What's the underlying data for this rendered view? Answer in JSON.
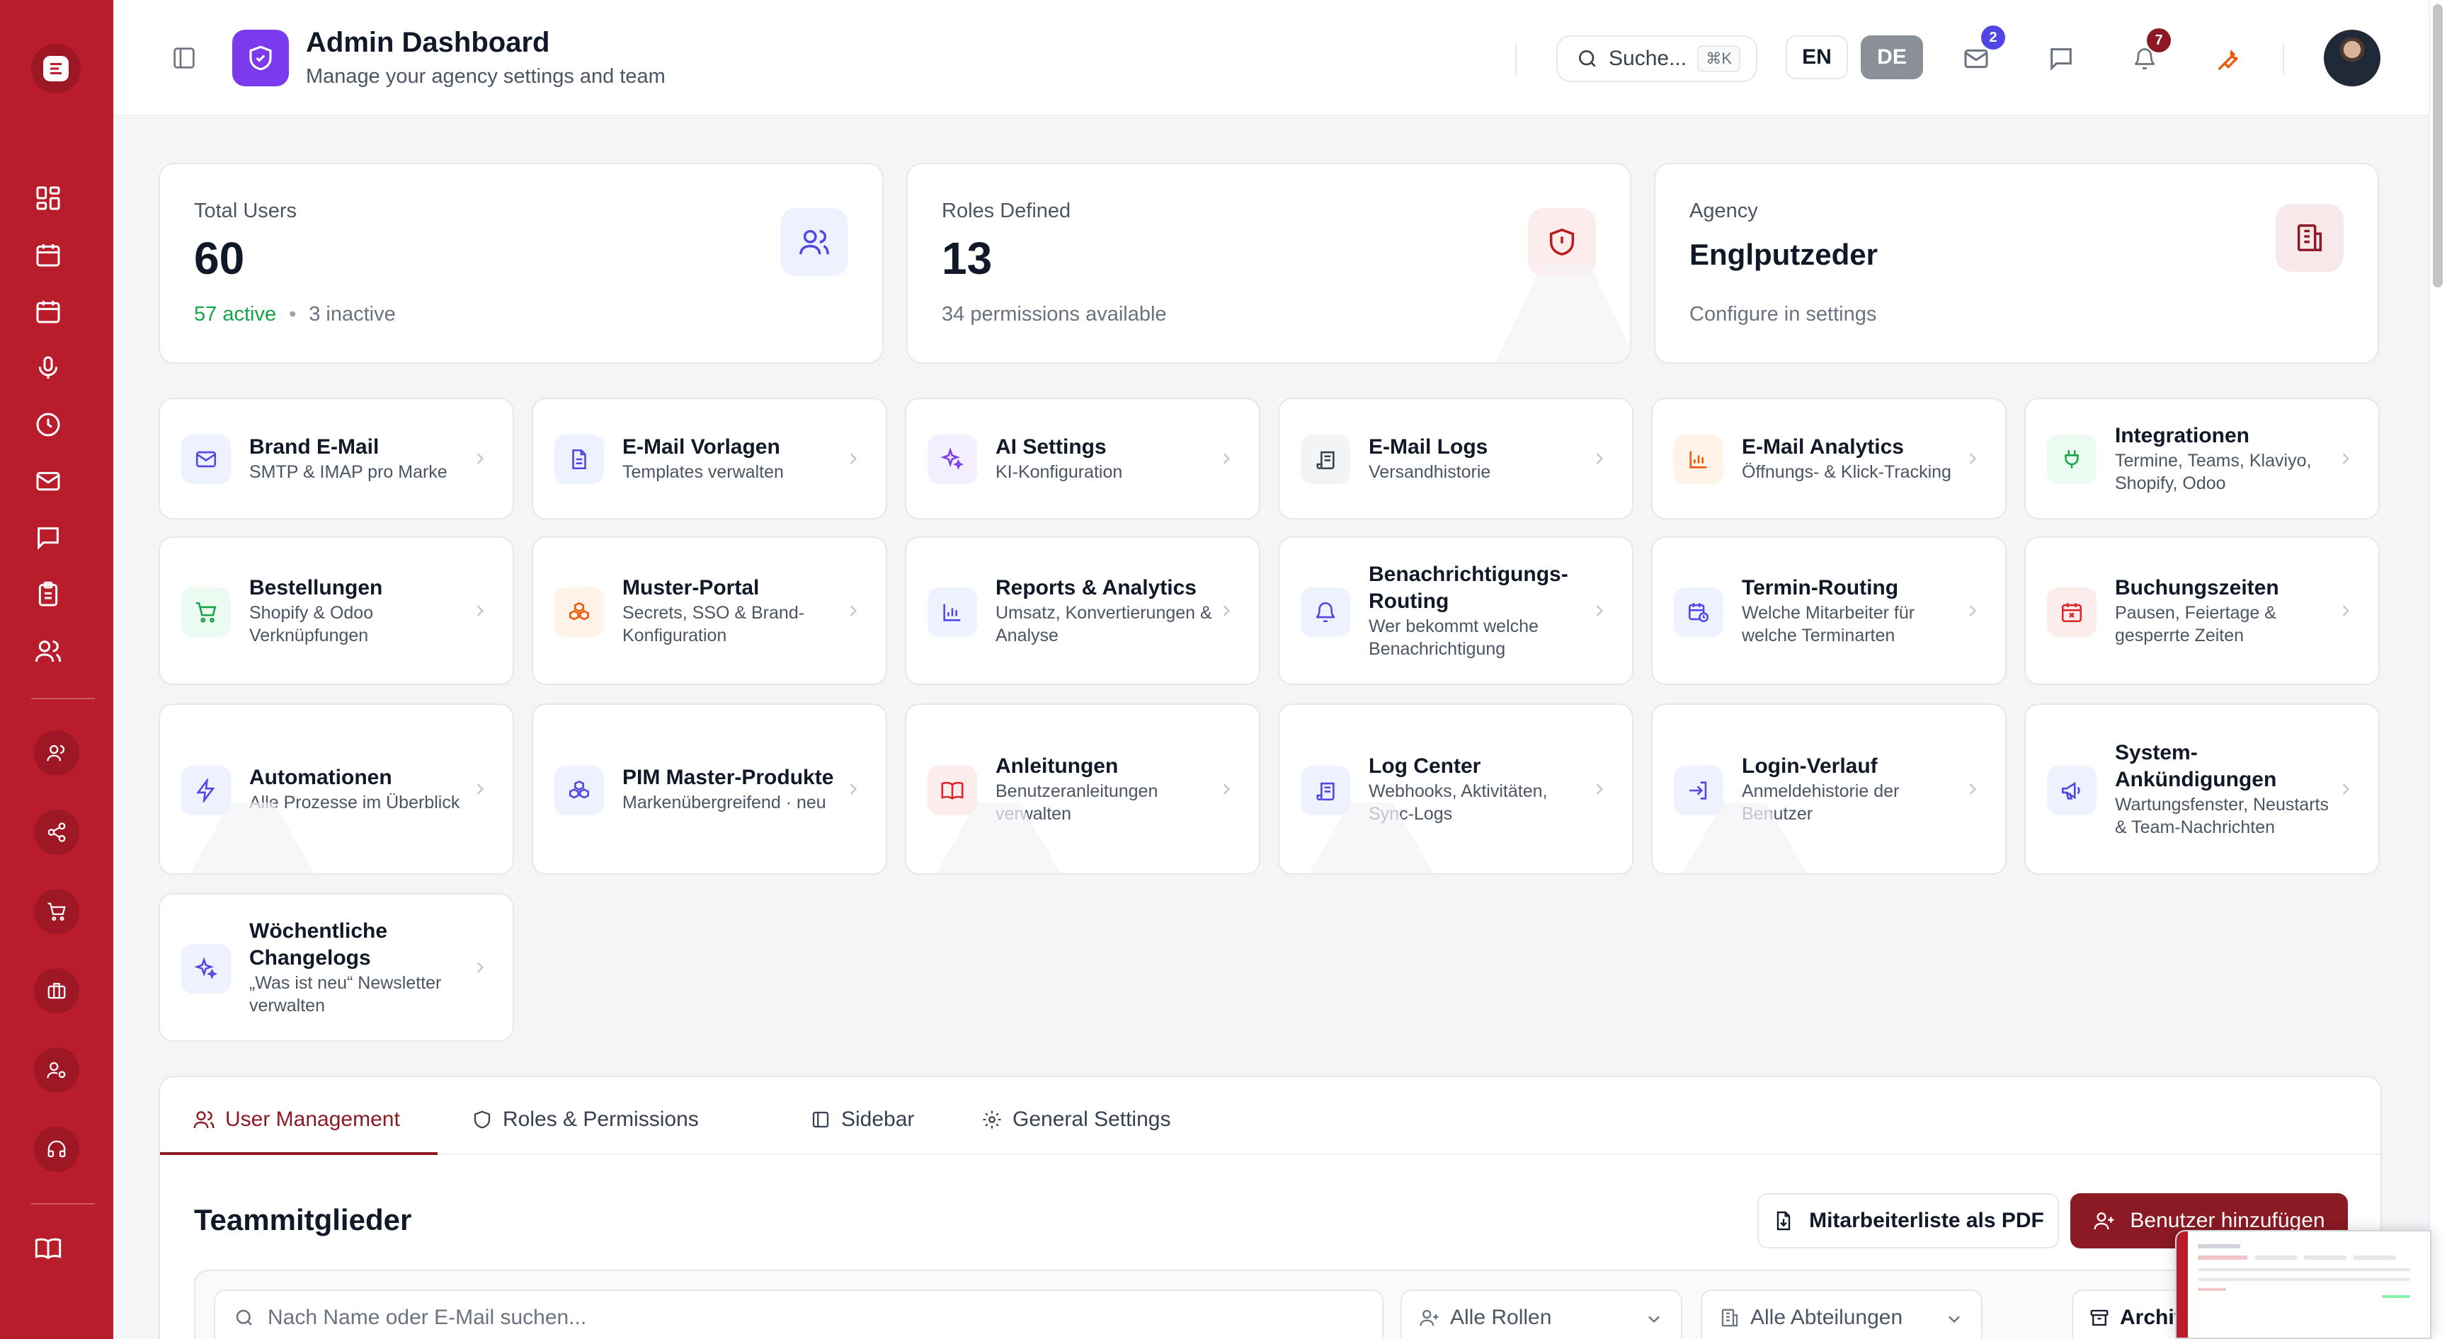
{
  "header": {
    "title": "Admin Dashboard",
    "subtitle": "Manage your agency settings and team",
    "search_placeholder": "Suche...",
    "search_shortcut": "⌘K",
    "lang_en": "EN",
    "lang_de": "DE",
    "mail_badge": "2",
    "notif_badge": "7",
    "icons": [
      "sidebar-toggle-icon",
      "shield-icon",
      "search-icon",
      "mail-icon",
      "chat-icon",
      "bell-icon",
      "wrench-icon"
    ]
  },
  "stats": {
    "users": {
      "label": "Total Users",
      "value": "60",
      "active": "57 active",
      "sep": "•",
      "inactive": "3 inactive"
    },
    "roles": {
      "label": "Roles Defined",
      "value": "13",
      "foot": "34 permissions available"
    },
    "agency": {
      "label": "Agency",
      "value": "Englputzeder",
      "foot": "Configure in settings"
    }
  },
  "cards": [
    {
      "title": "Brand E-Mail",
      "sub": "SMTP & IMAP pro Marke",
      "icon": "mail-icon",
      "color": "#4f46e5"
    },
    {
      "title": "E-Mail Vorlagen",
      "sub": "Templates verwalten",
      "icon": "file-text-icon",
      "color": "#4f46e5"
    },
    {
      "title": "AI Settings",
      "sub": "KI-Konfiguration",
      "icon": "sparkles-icon",
      "color": "#7c3aed"
    },
    {
      "title": "E-Mail Logs",
      "sub": "Versandhistorie",
      "icon": "scroll-icon",
      "color": "#374151"
    },
    {
      "title": "E-Mail Analytics",
      "sub": "Öffnungs- & Klick-Tracking",
      "icon": "bar-chart-icon",
      "color": "#ea580c"
    },
    {
      "title": "Integrationen",
      "sub": "Termine, Teams, Klaviyo, Shopify, Odoo",
      "icon": "plug-icon",
      "color": "#16a34a"
    },
    {
      "title": "Bestellungen",
      "sub": "Shopify & Odoo Verknüpfungen",
      "icon": "cart-icon",
      "color": "#16a34a"
    },
    {
      "title": "Muster-Portal",
      "sub": "Secrets, SSO & Brand-Konfiguration",
      "icon": "boxes-icon",
      "color": "#ea580c"
    },
    {
      "title": "Reports & Analytics",
      "sub": "Umsatz, Konvertierungen & Analyse",
      "icon": "bar-chart-icon",
      "color": "#4f46e5"
    },
    {
      "title": "Benachrichtigungs-Routing",
      "sub": "Wer bekommt welche Benachrichtigung",
      "icon": "bell-icon",
      "color": "#4f46e5"
    },
    {
      "title": "Termin-Routing",
      "sub": "Welche Mitarbeiter für welche Terminarten",
      "icon": "calendar-clock-icon",
      "color": "#4f46e5"
    },
    {
      "title": "Buchungszeiten",
      "sub": "Pausen, Feiertage & gesperrte Zeiten",
      "icon": "calendar-x-icon",
      "color": "#dc2626"
    },
    {
      "title": "Automationen",
      "sub": "Alle Prozesse im Überblick",
      "icon": "zap-icon",
      "color": "#4f46e5"
    },
    {
      "title": "PIM Master-Produkte",
      "sub": "Markenübergreifend · neu",
      "icon": "boxes-icon",
      "color": "#4f46e5"
    },
    {
      "title": "Anleitungen",
      "sub": "Benutzeranleitungen verwalten",
      "icon": "book-open-icon",
      "color": "#dc2626"
    },
    {
      "title": "Log Center",
      "sub": "Webhooks, Aktivitäten, Sync-Logs",
      "icon": "scroll-icon",
      "color": "#4f46e5"
    },
    {
      "title": "Login-Verlauf",
      "sub": "Anmeldehistorie der Benutzer",
      "icon": "log-in-icon",
      "color": "#4f46e5"
    },
    {
      "title": "System-Ankündigungen",
      "sub": "Wartungsfenster, Neustarts & Team-Nachrichten",
      "icon": "megaphone-icon",
      "color": "#4f46e5"
    },
    {
      "title": "Wöchentliche Changelogs",
      "sub": "„Was ist neu“ Newsletter verwalten",
      "icon": "sparkles-icon",
      "color": "#4f46e5"
    }
  ],
  "tabs": [
    "User Management",
    "Roles & Permissions",
    "Sidebar",
    "General Settings"
  ],
  "team": {
    "title": "Teammitglieder",
    "pdf_button": "Mitarbeiterliste als PDF",
    "add_button": "Benutzer hinzufügen",
    "search_placeholder": "Nach Name oder E-Mail suchen...",
    "roles_filter": "Alle Rollen",
    "departments_filter": "Alle Abteilungen",
    "archived": "Archivierte ei"
  },
  "colors": {
    "rail": "#b91c2a",
    "accent": "#8b1a24",
    "brand_tile": "#7c3aed",
    "active_green": "#16a34a"
  }
}
